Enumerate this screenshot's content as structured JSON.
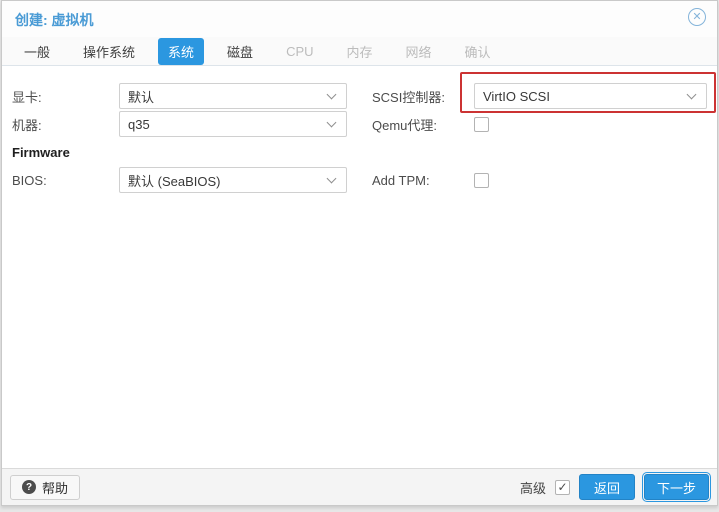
{
  "colors": {
    "accent": "#2b97e0",
    "title": "#4a9bd5",
    "annotation": "#cc3333"
  },
  "window": {
    "title": "创建: 虚拟机"
  },
  "tabs": [
    {
      "label": "一般",
      "state": "normal"
    },
    {
      "label": "操作系统",
      "state": "normal"
    },
    {
      "label": "系统",
      "state": "active"
    },
    {
      "label": "磁盘",
      "state": "normal"
    },
    {
      "label": "CPU",
      "state": "disabled"
    },
    {
      "label": "内存",
      "state": "disabled"
    },
    {
      "label": "网络",
      "state": "disabled"
    },
    {
      "label": "确认",
      "state": "disabled"
    }
  ],
  "form": {
    "left": {
      "video_card": {
        "label": "显卡:",
        "value": "默认"
      },
      "machine": {
        "label": "机器:",
        "value": "q35"
      },
      "firmware_section": "Firmware",
      "bios": {
        "label": "BIOS:",
        "value": "默认 (SeaBIOS)"
      }
    },
    "right": {
      "scsi_controller": {
        "label": "SCSI控制器:",
        "value": "VirtIO SCSI",
        "annotated": true
      },
      "qemu_agent": {
        "label": "Qemu代理:",
        "checked": false
      },
      "add_tpm": {
        "label": "Add TPM:",
        "checked": false
      }
    }
  },
  "footer": {
    "help": "帮助",
    "advanced": {
      "label": "高级",
      "checked": true
    },
    "back": "返回",
    "next": "下一步"
  }
}
